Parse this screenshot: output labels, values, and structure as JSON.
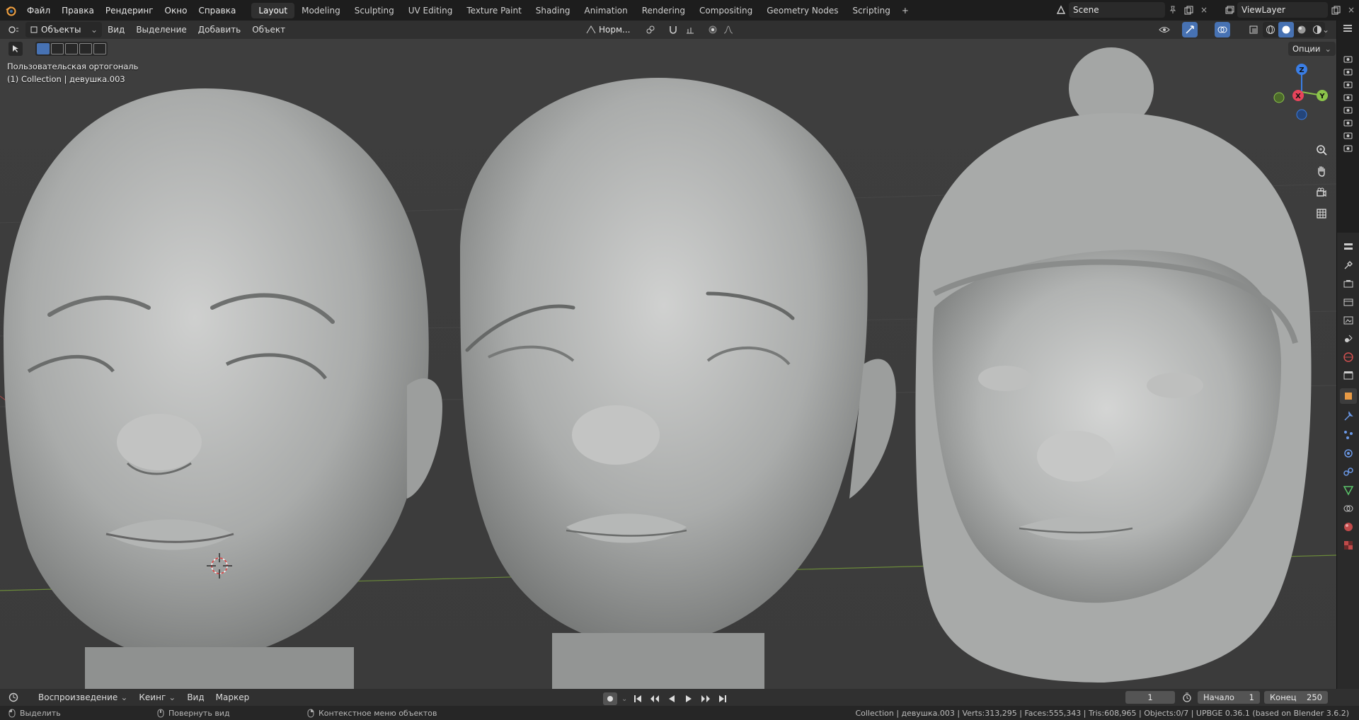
{
  "colors": {
    "accent": "#4772b3",
    "axis_x": "#e8445b",
    "axis_y": "#8bc34a",
    "axis_z": "#3a7ee6",
    "viewport_bg": "#3f3f3f",
    "header_bg": "#303030"
  },
  "topbar": {
    "menus": [
      "Файл",
      "Правка",
      "Рендеринг",
      "Окно",
      "Справка"
    ],
    "workspaces": [
      "Layout",
      "Modeling",
      "Sculpting",
      "UV Editing",
      "Texture Paint",
      "Shading",
      "Animation",
      "Rendering",
      "Compositing",
      "Geometry Nodes",
      "Scripting"
    ],
    "active_workspace": "Layout",
    "scene": "Scene",
    "view_layer": "ViewLayer"
  },
  "viewport_header": {
    "mode": "Объекты",
    "menus": [
      "Вид",
      "Выделение",
      "Добавить",
      "Объект"
    ],
    "orientation": "Норм...",
    "options_label": "Опции"
  },
  "viewport": {
    "view_name": "Пользовательская ортогональ",
    "object_info": "(1) Collection | девушка.003",
    "gizmo": {
      "x": "X",
      "y": "Y",
      "z": "Z"
    }
  },
  "timeline": {
    "playback": "Воспроизведение",
    "keying": "Кеинг",
    "view": "Вид",
    "marker": "Маркер",
    "current_frame": "1",
    "start_label": "Начало",
    "start_value": "1",
    "end_label": "Конец",
    "end_value": "250"
  },
  "statusbar": {
    "select": "Выделить",
    "rotate": "Повернуть вид",
    "context": "Контекстное меню объектов",
    "stats": "Collection | девушка.003 | Verts:313,295 | Faces:555,343 | Tris:608,965 | Objects:0/7 | UPBGE 0.36.1 (based on Blender 3.6.2)"
  }
}
